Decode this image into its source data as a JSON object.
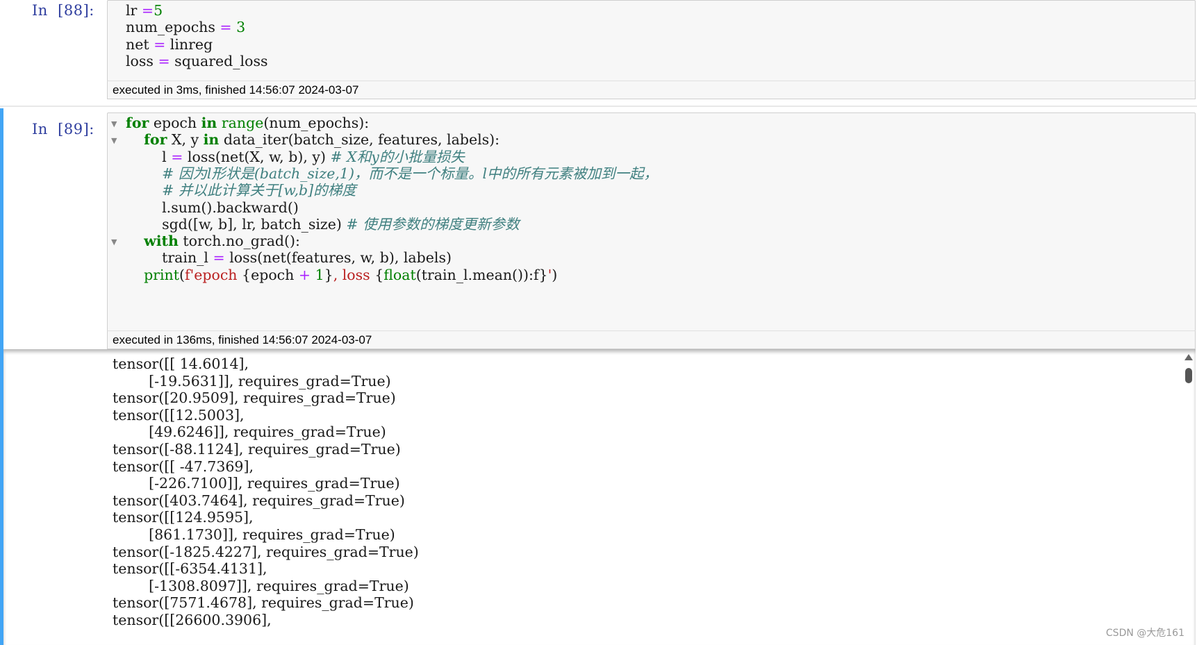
{
  "cell88": {
    "prompt": "In  [88]:",
    "lines": [
      [
        {
          "t": "lr ",
          "c": ""
        },
        {
          "t": "=",
          "c": "op"
        },
        {
          "t": "5",
          "c": "num"
        }
      ],
      [
        {
          "t": "num_epochs ",
          "c": ""
        },
        {
          "t": "=",
          "c": "op"
        },
        {
          "t": " ",
          "c": ""
        },
        {
          "t": "3",
          "c": "num"
        }
      ],
      [
        {
          "t": "net ",
          "c": ""
        },
        {
          "t": "=",
          "c": "op"
        },
        {
          "t": " linreg",
          "c": ""
        }
      ],
      [
        {
          "t": "loss ",
          "c": ""
        },
        {
          "t": "=",
          "c": "op"
        },
        {
          "t": " squared_loss",
          "c": ""
        }
      ]
    ],
    "exec_text": "executed in 3ms, finished 14:56:07 2024-03-07"
  },
  "cell89": {
    "prompt": "In  [89]:",
    "lines": [
      [
        {
          "t": "for",
          "c": "kw"
        },
        {
          "t": " epoch ",
          "c": ""
        },
        {
          "t": "in",
          "c": "kw"
        },
        {
          "t": " ",
          "c": ""
        },
        {
          "t": "range",
          "c": "bi"
        },
        {
          "t": "(num_epochs):",
          "c": ""
        }
      ],
      [
        {
          "t": "    ",
          "c": ""
        },
        {
          "t": "for",
          "c": "kw"
        },
        {
          "t": " X, y ",
          "c": ""
        },
        {
          "t": "in",
          "c": "kw"
        },
        {
          "t": " data_iter(batch_size, features, labels):",
          "c": ""
        }
      ],
      [
        {
          "t": "        l ",
          "c": ""
        },
        {
          "t": "=",
          "c": "op"
        },
        {
          "t": " loss(net(X, w, b), y) ",
          "c": ""
        },
        {
          "t": "# X和y的小批量损失",
          "c": "cm"
        }
      ],
      [
        {
          "t": "        ",
          "c": ""
        },
        {
          "t": "# 因为l形状是(batch_size,1)，而不是一个标量。l中的所有元素被加到一起，",
          "c": "cm"
        }
      ],
      [
        {
          "t": "        ",
          "c": ""
        },
        {
          "t": "# 并以此计算关于[w,b]的梯度",
          "c": "cm"
        }
      ],
      [
        {
          "t": "        l.sum().backward()",
          "c": ""
        }
      ],
      [
        {
          "t": "        sgd([w, b], lr, batch_size) ",
          "c": ""
        },
        {
          "t": "# 使用参数的梯度更新参数",
          "c": "cm"
        }
      ],
      [
        {
          "t": "    ",
          "c": ""
        },
        {
          "t": "with",
          "c": "kw"
        },
        {
          "t": " torch.no_grad():",
          "c": ""
        }
      ],
      [
        {
          "t": "        train_l ",
          "c": ""
        },
        {
          "t": "=",
          "c": "op"
        },
        {
          "t": " loss(net(features, w, b), labels)",
          "c": ""
        }
      ],
      [
        {
          "t": "    ",
          "c": ""
        },
        {
          "t": "print",
          "c": "bi"
        },
        {
          "t": "(",
          "c": ""
        },
        {
          "t": "f'epoch ",
          "c": "st"
        },
        {
          "t": "{epoch ",
          "c": ""
        },
        {
          "t": "+",
          "c": "op"
        },
        {
          "t": " ",
          "c": ""
        },
        {
          "t": "1",
          "c": "num"
        },
        {
          "t": "}",
          "c": ""
        },
        {
          "t": ", loss ",
          "c": "st"
        },
        {
          "t": "{",
          "c": ""
        },
        {
          "t": "float",
          "c": "bi"
        },
        {
          "t": "(train_l.mean()):f}",
          "c": ""
        },
        {
          "t": "'",
          "c": "st"
        },
        {
          "t": ")",
          "c": ""
        }
      ]
    ],
    "fold_rows": [
      0,
      1,
      7
    ],
    "exec_text": "executed in 136ms, finished 14:56:07 2024-03-07"
  },
  "output": {
    "lines": [
      "tensor([[ 14.6014],",
      "        [-19.5631]], requires_grad=True)",
      "tensor([20.9509], requires_grad=True)",
      "tensor([[12.5003],",
      "        [49.6246]], requires_grad=True)",
      "tensor([-88.1124], requires_grad=True)",
      "tensor([[ -47.7369],",
      "        [-226.7100]], requires_grad=True)",
      "tensor([403.7464], requires_grad=True)",
      "tensor([[124.9595],",
      "        [861.1730]], requires_grad=True)",
      "tensor([-1825.4227], requires_grad=True)",
      "tensor([[-6354.4131],",
      "        [-1308.8097]], requires_grad=True)",
      "tensor([7571.4678], requires_grad=True)",
      "tensor([[26600.3906],"
    ]
  },
  "icons": {
    "fold_marker": "fold-triangle-icon",
    "scroll_up": "scroll-up-arrow-icon"
  },
  "watermark": "CSDN @大危161",
  "colors": {
    "keyword": "#008000",
    "operator": "#aa22ff",
    "comment": "#408080",
    "string": "#ba2121",
    "prompt": "#303f9f",
    "selection_bar": "#42a5f5"
  }
}
